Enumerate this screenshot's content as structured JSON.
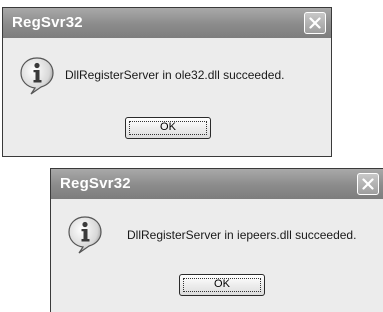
{
  "dialogs": [
    {
      "title": "RegSvr32",
      "message": "DllRegisterServer in ole32.dll succeeded.",
      "ok_label": "OK",
      "icon": "information-icon"
    },
    {
      "title": "RegSvr32",
      "message": "DllRegisterServer in iepeers.dll succeeded.",
      "ok_label": "OK",
      "icon": "information-icon"
    }
  ],
  "colors": {
    "titlebar": "#8b8b8b",
    "dialog_background": "#ececec",
    "title_text": "#ffffff"
  }
}
